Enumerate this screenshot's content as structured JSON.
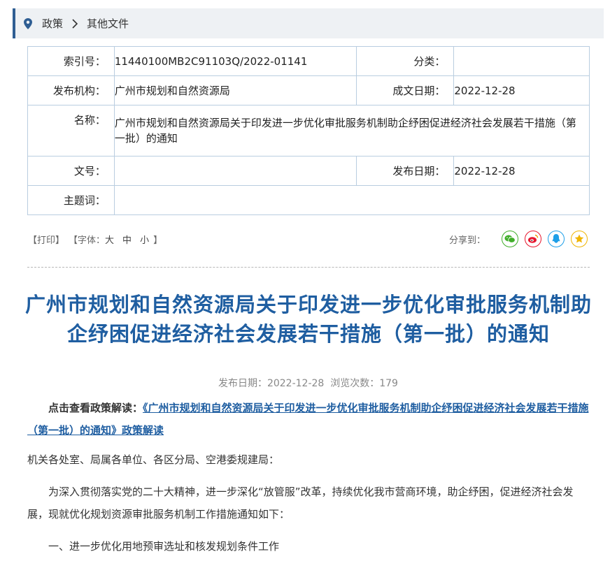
{
  "breadcrumb": {
    "items": [
      "政策",
      "其他文件"
    ]
  },
  "meta": {
    "index_label": "索引号：",
    "index_value": "11440100MB2C91103Q/2022-01141",
    "category_label": "分类：",
    "category_value": "",
    "publisher_label": "发布机构：",
    "publisher_value": "广州市规划和自然资源局",
    "written_date_label": "成文日期：",
    "written_date_value": "2022-12-28",
    "name_label": "名称：",
    "name_value": "广州市规划和自然资源局关于印发进一步优化审批服务机制助企纾困促进经济社会发展若干措施（第一批）的通知",
    "doc_no_label": "文号：",
    "doc_no_value": "",
    "publish_date_label": "发布日期：",
    "publish_date_value": "2022-12-28",
    "subject_label": "主题词：",
    "subject_value": ""
  },
  "tools": {
    "print": "【打印】",
    "font_prefix": "【字体：",
    "font_large": "大",
    "font_medium": "中",
    "font_small": "小",
    "font_suffix": "】",
    "share_label": "分享到：",
    "share_icons": [
      "wechat-icon",
      "weibo-icon",
      "qq-icon",
      "qzone-icon"
    ],
    "share_colors": {
      "wechat": "#3fae29",
      "weibo": "#e6162d",
      "qq": "#1e9fe8",
      "qzone": "#f0b400"
    }
  },
  "article": {
    "title": "广州市规划和自然资源局关于印发进一步优化审批服务机制助企纾困促进经济社会发展若干措施（第一批）的通知",
    "info": "发布日期：2022-12-28  浏览次数：179",
    "lead_label": "点击查看政策解读：",
    "lead_link": "《广州市规划和自然资源局关于印发进一步优化审批服务机制助企纾困促进经济社会发展若干措施（第一批）的通知》政策解读",
    "recipients": "机关各处室、局属各单位、各区分局、空港委规建局：",
    "paragraph1": "为深入贯彻落实党的二十大精神，进一步深化“放管服”改革，持续优化我市营商环境，助企纾困，促进经济社会发展，现就优化规划资源审批服务机制工作措施通知如下：",
    "section1": "一、进一步优化用地预审选址和核发规划条件工作"
  },
  "colors": {
    "title": "#1f5ea1",
    "border": "#b9cde0",
    "accent": "#2f5e93"
  }
}
